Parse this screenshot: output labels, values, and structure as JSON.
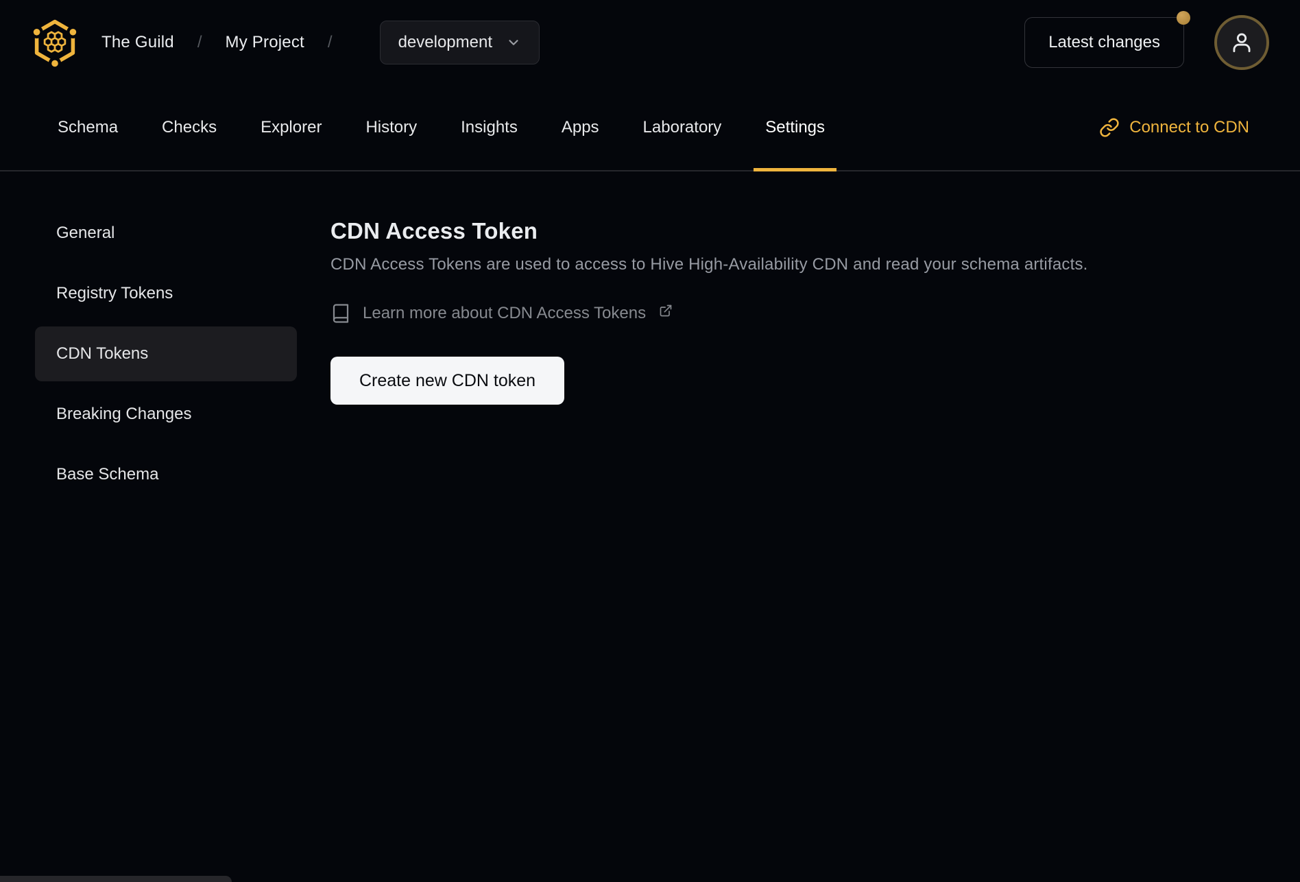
{
  "header": {
    "org_name": "The Guild",
    "separator": "/",
    "project_name": "My Project",
    "target_dropdown": {
      "selected": "development"
    },
    "latest_changes": {
      "label": "Latest changes",
      "has_notification": true
    }
  },
  "tabs": {
    "items": [
      {
        "label": "Schema"
      },
      {
        "label": "Checks"
      },
      {
        "label": "Explorer"
      },
      {
        "label": "History"
      },
      {
        "label": "Insights"
      },
      {
        "label": "Apps"
      },
      {
        "label": "Laboratory"
      },
      {
        "label": "Settings",
        "active": true
      }
    ],
    "connect_cdn": {
      "label": "Connect to CDN"
    }
  },
  "sidebar": {
    "items": [
      {
        "label": "General"
      },
      {
        "label": "Registry Tokens"
      },
      {
        "label": "CDN Tokens",
        "active": true
      },
      {
        "label": "Breaking Changes"
      },
      {
        "label": "Base Schema"
      }
    ]
  },
  "main": {
    "title": "CDN Access Token",
    "description": "CDN Access Tokens are used to access to Hive High-Availability CDN and read your schema artifacts.",
    "learn_more": {
      "label": "Learn more about CDN Access Tokens"
    },
    "create_button": {
      "label": "Create new CDN token"
    }
  },
  "icons": {
    "logo": "hive-honeycomb-logo",
    "chevron": "chevron-down-icon",
    "user": "user-icon",
    "link": "link-icon",
    "book": "book-icon",
    "external_link": "external-link-icon"
  },
  "colors": {
    "background": "#04060b",
    "accent_gold": "#efb43d",
    "notification_dot": "#bb9348",
    "avatar_ring": "#6f5d33",
    "active_item_bg": "#1c1c20",
    "button_bg": "#f5f6f8",
    "muted_text": "#979ba3"
  }
}
